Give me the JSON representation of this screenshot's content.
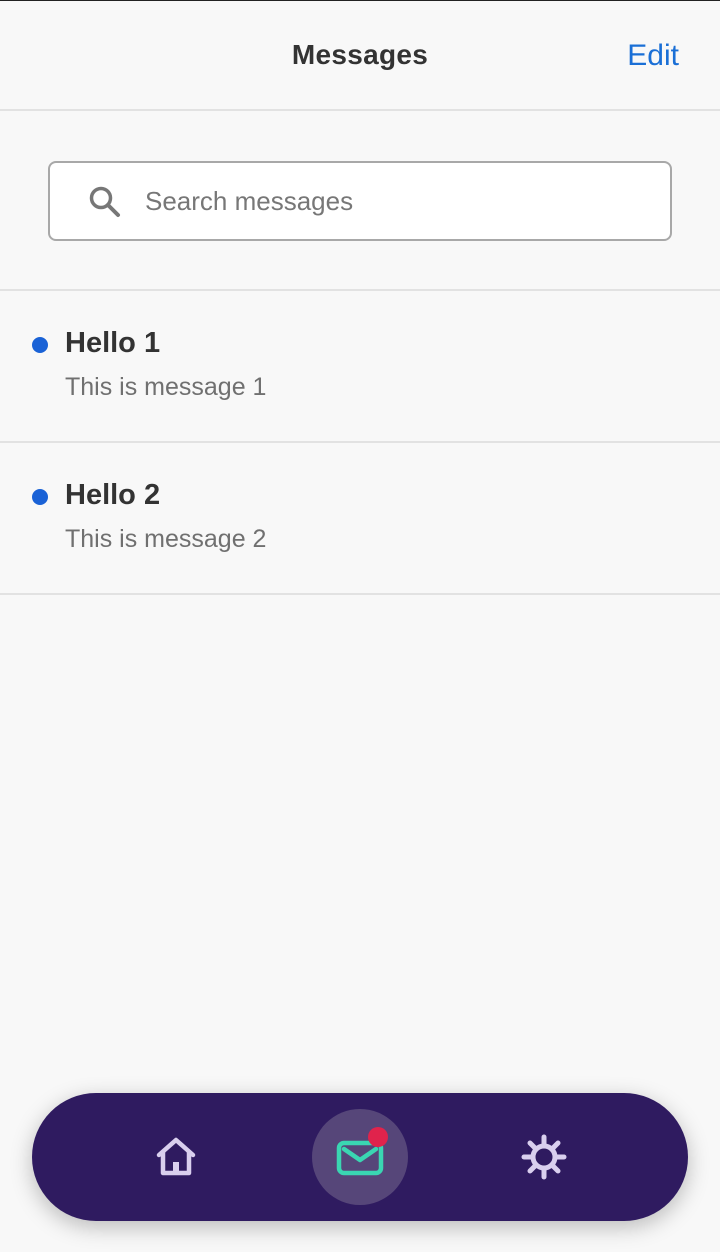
{
  "header": {
    "title": "Messages",
    "edit_label": "Edit"
  },
  "search": {
    "placeholder": "Search messages",
    "value": ""
  },
  "messages": [
    {
      "title": "Hello 1",
      "body": "This is message 1",
      "unread": true
    },
    {
      "title": "Hello 2",
      "body": "This is message 2",
      "unread": true
    }
  ],
  "navbar": {
    "items": [
      {
        "icon": "home-icon",
        "active": false
      },
      {
        "icon": "mail-icon",
        "active": true,
        "badge": true
      },
      {
        "icon": "gear-icon",
        "active": false
      }
    ]
  },
  "colors": {
    "accent": "#1a6fd6",
    "unread_dot": "#1a62d6",
    "navbar_bg": "#2f1b60",
    "nav_active_bg": "#564679",
    "nav_icon": "#d9cfee",
    "mail_icon": "#3ad6b2",
    "badge": "#e0234c"
  }
}
